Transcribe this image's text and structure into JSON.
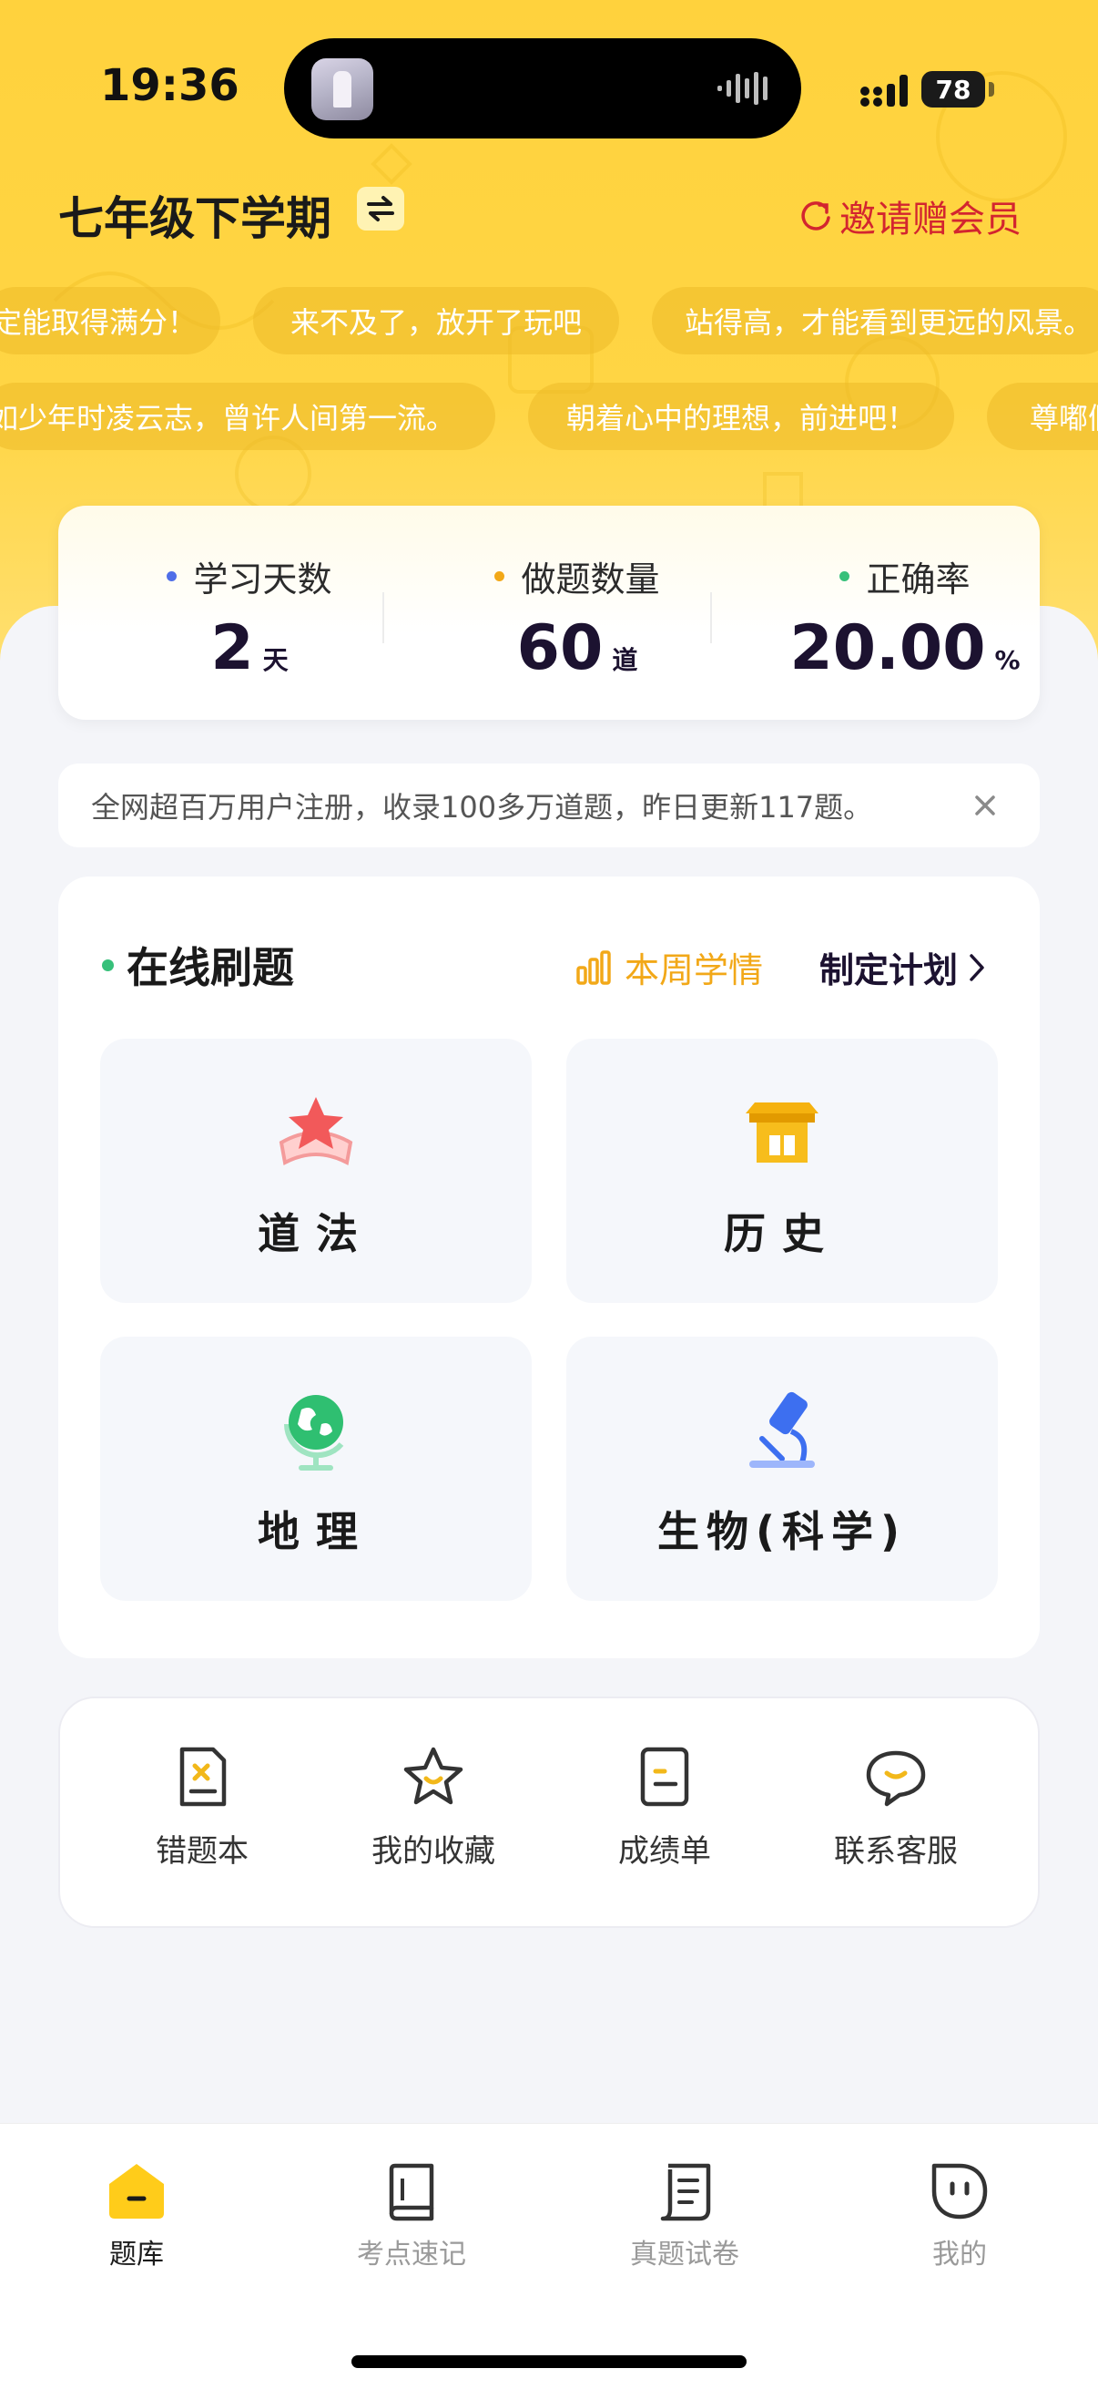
{
  "status_bar": {
    "time": "19:36",
    "battery": "78"
  },
  "header": {
    "term": "七年级下学期",
    "invite": "邀请赠会员"
  },
  "mottos_row1": [
    "定能取得满分！",
    "来不及了，放开了玩吧",
    "站得高，才能看到更远的风景。"
  ],
  "mottos_row2": [
    "如少年时凌云志，曾许人间第一流。",
    "朝着心中的理想，前进吧！",
    "尊嘟假"
  ],
  "stats": [
    {
      "label": "学习天数",
      "value": "2",
      "unit": "天",
      "dot_color": "#4f6ee8"
    },
    {
      "label": "做题数量",
      "value": "60",
      "unit": "道",
      "dot_color": "#f2a818"
    },
    {
      "label": "正确率",
      "value": "20.00",
      "unit": "%",
      "dot_color": "#37c07a"
    }
  ],
  "notice": {
    "text": "全网超百万用户注册，收录100多万道题，昨日更新117题。"
  },
  "practice": {
    "title": "在线刷题",
    "weekly": "本周学情",
    "plan": "制定计划",
    "subjects": [
      {
        "name": "道法",
        "icon": "star-ribbon-icon"
      },
      {
        "name": "历史",
        "icon": "temple-icon"
      },
      {
        "name": "地理",
        "icon": "globe-icon"
      },
      {
        "name": "生物(科学)",
        "icon": "microscope-icon"
      }
    ]
  },
  "tools": [
    {
      "label": "错题本",
      "icon": "mistake-book-icon"
    },
    {
      "label": "我的收藏",
      "icon": "star-icon"
    },
    {
      "label": "成绩单",
      "icon": "report-icon"
    },
    {
      "label": "联系客服",
      "icon": "chat-icon"
    }
  ],
  "bottom_nav": [
    {
      "label": "题库",
      "active": true
    },
    {
      "label": "考点速记",
      "active": false
    },
    {
      "label": "真题试卷",
      "active": false
    },
    {
      "label": "我的",
      "active": false
    }
  ],
  "colors": {
    "brand_yellow": "#ffd23d",
    "accent_orange": "#f2a818",
    "invite_red": "#d3252f",
    "dark_text": "#1c1230"
  }
}
